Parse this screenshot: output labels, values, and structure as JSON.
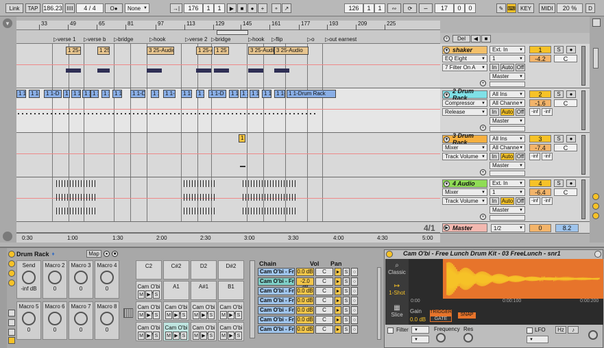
{
  "transport": {
    "link": "Link",
    "tap": "TAP",
    "tempo": "186.23",
    "meter_bars_icon": "IIII",
    "signature": "4 / 4",
    "metronome": "O●",
    "quantize": "None",
    "follow_icon": "→|",
    "position": [
      "176",
      "1",
      "1"
    ],
    "loop_start": [
      "126",
      "1",
      "1"
    ],
    "loop_length": [
      "17",
      "0",
      "0"
    ],
    "key": "KEY",
    "midi": "MIDI",
    "cpu": "20 %",
    "d": "D"
  },
  "ruler_numbers": [
    "33",
    "49",
    "65",
    "81",
    "97",
    "113",
    "129",
    "145",
    "161",
    "177",
    "193",
    "209",
    "225"
  ],
  "time_ruler": [
    "0:30",
    "1:00",
    "1:30",
    "2:00",
    "2:30",
    "3:00",
    "3:30",
    "4:00",
    "4:30",
    "5:00"
  ],
  "locators": [
    "verse 1",
    "verse b",
    "bridge",
    "hook",
    "verse 2",
    "bridge",
    "hook",
    "flip",
    "o",
    "out earnest"
  ],
  "header_controls": {
    "del": "Del"
  },
  "tracks": [
    {
      "name": "shaker",
      "color": "#f3c06a",
      "input": "Ext. In",
      "chan": "1",
      "device1": "EQ Eight",
      "device2": "7 Filter On A",
      "master": "Master",
      "num": "1",
      "vol": "-4.2",
      "pan": "C",
      "mode": "Auto",
      "off": "Off",
      "clip_label": "1 25-A",
      "clip_label2": "1 25",
      "clip_label3": "3 25-Audio",
      "clip_label4": "1 25-A",
      "clip_label5": "1 25",
      "clip_label6": "3 25-Audio",
      "clip_label7": "3 25-Audio"
    },
    {
      "name": "2 Drum Rack",
      "color": "#7fe0e6",
      "input": "All Ins",
      "chan": "All Channe",
      "device1": "Compressor",
      "device2": "Release",
      "master": "Master",
      "num": "2",
      "vol": "-1.6",
      "pan": "C",
      "mode": "Auto",
      "off": "Off",
      "inf1": "-inf",
      "inf2": "-inf",
      "clip_label": "1 1-Drum Rack",
      "clip_label2": "1 1-D"
    },
    {
      "name": "3 Drum Rack",
      "color": "#f6b040",
      "input": "All Ins",
      "chan": "All Channe",
      "device1": "Mixer",
      "device2": "Track Volume",
      "master": "Master",
      "num": "3",
      "vol": "-7.4",
      "pan": "C",
      "mode": "Auto",
      "off": "Off",
      "inf1": "-inf",
      "inf2": "-inf",
      "clip_label": "1"
    },
    {
      "name": "4 Audio",
      "color": "#8fdc55",
      "input": "Ext. In",
      "chan": "1",
      "device1": "Mixer",
      "device2": "Track Volume",
      "master": "Master",
      "num": "4",
      "vol": "-6.4",
      "pan": "C",
      "mode": "Auto",
      "off": "Off",
      "inf1": "-inf",
      "inf2": "-inf"
    }
  ],
  "master": {
    "name": "Master",
    "chan": "1/2",
    "vol": "0",
    "pan": "8.2",
    "bar": "4/1"
  },
  "in_label": "In",
  "s_label": "S",
  "m_label": "M",
  "drum_rack": {
    "title": "Drum Rack",
    "map": "Map",
    "macros": [
      {
        "label": "Send",
        "value": "-inf dB"
      },
      {
        "label": "Macro 2",
        "value": "0"
      },
      {
        "label": "Macro 3",
        "value": "0"
      },
      {
        "label": "Macro 4",
        "value": "0"
      },
      {
        "label": "Macro 5",
        "value": "0"
      },
      {
        "label": "Macro 6",
        "value": "0"
      },
      {
        "label": "Macro 7",
        "value": "0"
      },
      {
        "label": "Macro 8",
        "value": "0"
      }
    ],
    "pads_row1": [
      "C2",
      "C#2",
      "D2",
      "D#2"
    ],
    "pads_row2": [
      "Cam O'bi - Free",
      "A1",
      "A#1",
      "B1"
    ],
    "pads_row3": [
      "Cam O'bi - Free",
      "Cam O'bi - Free",
      "Cam O'bi - Free",
      "Cam O'bi - Free"
    ],
    "pads_row4": [
      "Cam O'bi - Free",
      "Cam O'bi - Free",
      "Cam O'bi - Free",
      "Cam O'bi - Free"
    ],
    "chain_headers": {
      "chain": "Chain",
      "vol": "Vol",
      "pan": "Pan"
    },
    "chains": [
      {
        "name": "Cam O'bi - Fr...",
        "vol": "0.0 dB",
        "pan": "C"
      },
      {
        "name": "Cam O'bi - Fr...",
        "vol": "-2.0 dB",
        "pan": "C"
      },
      {
        "name": "Cam O'bi - Fr...",
        "vol": "0.0 dB",
        "pan": "C"
      },
      {
        "name": "Cam O'bi - Fr...",
        "vol": "0.0 dB",
        "pan": "C"
      },
      {
        "name": "Cam O'bi - Fr...",
        "vol": "0.0 dB",
        "pan": "C"
      },
      {
        "name": "Cam O'bi - Fr...",
        "vol": "0.0 dB",
        "pan": "C"
      },
      {
        "name": "Cam O'bi - Fr...",
        "vol": "0.0 dB",
        "pan": "C"
      }
    ]
  },
  "sampler": {
    "title": "Cam O'bi - Free Lunch Drum Kit - 03 FreeLunch - snr1",
    "modes": [
      "Classic",
      "1-Shot",
      "Slice"
    ],
    "gain_label": "Gain",
    "gain": "0.0 dB",
    "trigger": "TRIGGER",
    "gate": "GATE",
    "snap": "SNAP",
    "time_start": "0:00",
    "time_mid": "0:00:100",
    "time_end": "0:00:200",
    "filter": "Filter",
    "frequency": "Frequency",
    "res": "Res",
    "lfo": "LFO",
    "hz": "Hz",
    "note_icon": "♪"
  }
}
